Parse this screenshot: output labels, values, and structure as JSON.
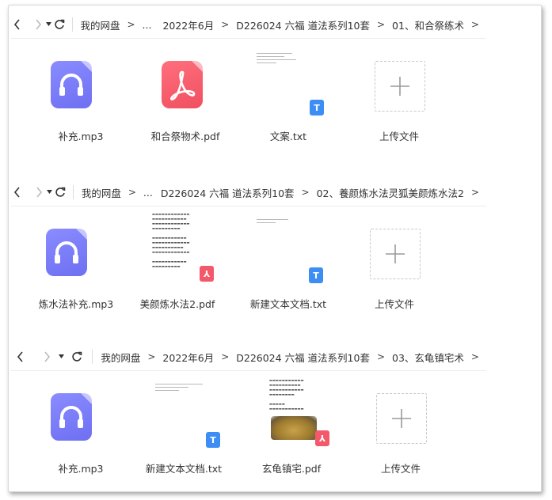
{
  "panels": [
    {
      "breadcrumb": [
        "我的网盘",
        "...",
        "2022年6月",
        "D226024 六福 道法系列10套",
        "01、和合祭练术"
      ],
      "files": [
        {
          "name": "补充.mp3",
          "type": "audio"
        },
        {
          "name": "和合祭物术.pdf",
          "type": "pdf"
        },
        {
          "name": "文案.txt",
          "type": "txt"
        },
        {
          "name": "上传文件",
          "type": "upload"
        }
      ]
    },
    {
      "breadcrumb": [
        "我的网盘",
        "...",
        "D226024 六福 道法系列10套",
        "02、養颜炼水法灵狐美颜炼水法2"
      ],
      "files": [
        {
          "name": "炼水法补充.mp3",
          "type": "audio"
        },
        {
          "name": "美颜炼水法2.pdf",
          "type": "pdf-doc"
        },
        {
          "name": "新建文本文档.txt",
          "type": "txt"
        },
        {
          "name": "上传文件",
          "type": "upload"
        }
      ]
    },
    {
      "breadcrumb": [
        "我的网盘",
        "2022年6月",
        "D226024 六福 道法系列10套",
        "03、玄龟镇宅术"
      ],
      "files": [
        {
          "name": "补充.mp3",
          "type": "audio"
        },
        {
          "name": "新建文本文档.txt",
          "type": "txt"
        },
        {
          "name": "玄龟镇宅.pdf",
          "type": "pdf-doc"
        },
        {
          "name": "上传文件",
          "type": "upload"
        }
      ]
    }
  ],
  "icons": {
    "back": "chevron-left-icon",
    "forward": "chevron-right-icon",
    "dropdown": "caret-down-icon",
    "refresh": "refresh-icon",
    "audio": "headphones-icon",
    "pdf": "acrobat-icon",
    "upload": "plus-icon"
  },
  "colors": {
    "audio_tile": "#7b7df8",
    "pdf_tile": "#f65c6b",
    "txt_badge": "#3c8ef5",
    "pdf_badge": "#f3596a"
  }
}
